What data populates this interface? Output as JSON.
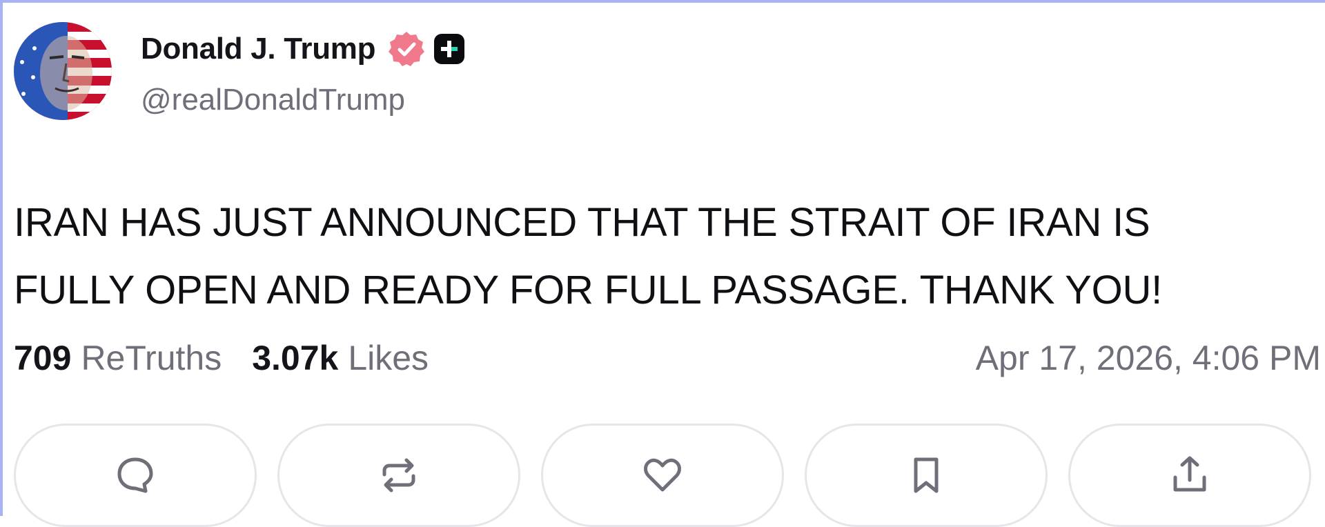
{
  "post": {
    "author_name": "Donald J. Trump",
    "handle": "@realDonaldTrump",
    "text_lines": [
      "IRAN HAS JUST ANNOUNCED THAT THE STRAIT OF IRAN IS",
      "FULLY OPEN AND READY FOR FULL PASSAGE. THANK YOU!"
    ],
    "retruths_count": "709",
    "retruths_label": "ReTruths",
    "likes_count": "3.07k",
    "likes_label": "Likes",
    "timestamp": "Apr 17, 2026, 4:06 PM"
  },
  "badges": {
    "verified_icon": "verified-check-icon",
    "verified_color": "#f07a8c",
    "plus_icon": "plus-badge-icon",
    "plus_color": "#0b0b0f"
  },
  "actions": [
    {
      "icon": "reply-icon"
    },
    {
      "icon": "retruth-icon"
    },
    {
      "icon": "like-heart-icon"
    },
    {
      "icon": "bookmark-icon"
    },
    {
      "icon": "share-icon"
    }
  ],
  "colors": {
    "card_border": "#a9b3f2",
    "muted_text": "#6f6f7a",
    "button_border": "#e6e6ea"
  }
}
